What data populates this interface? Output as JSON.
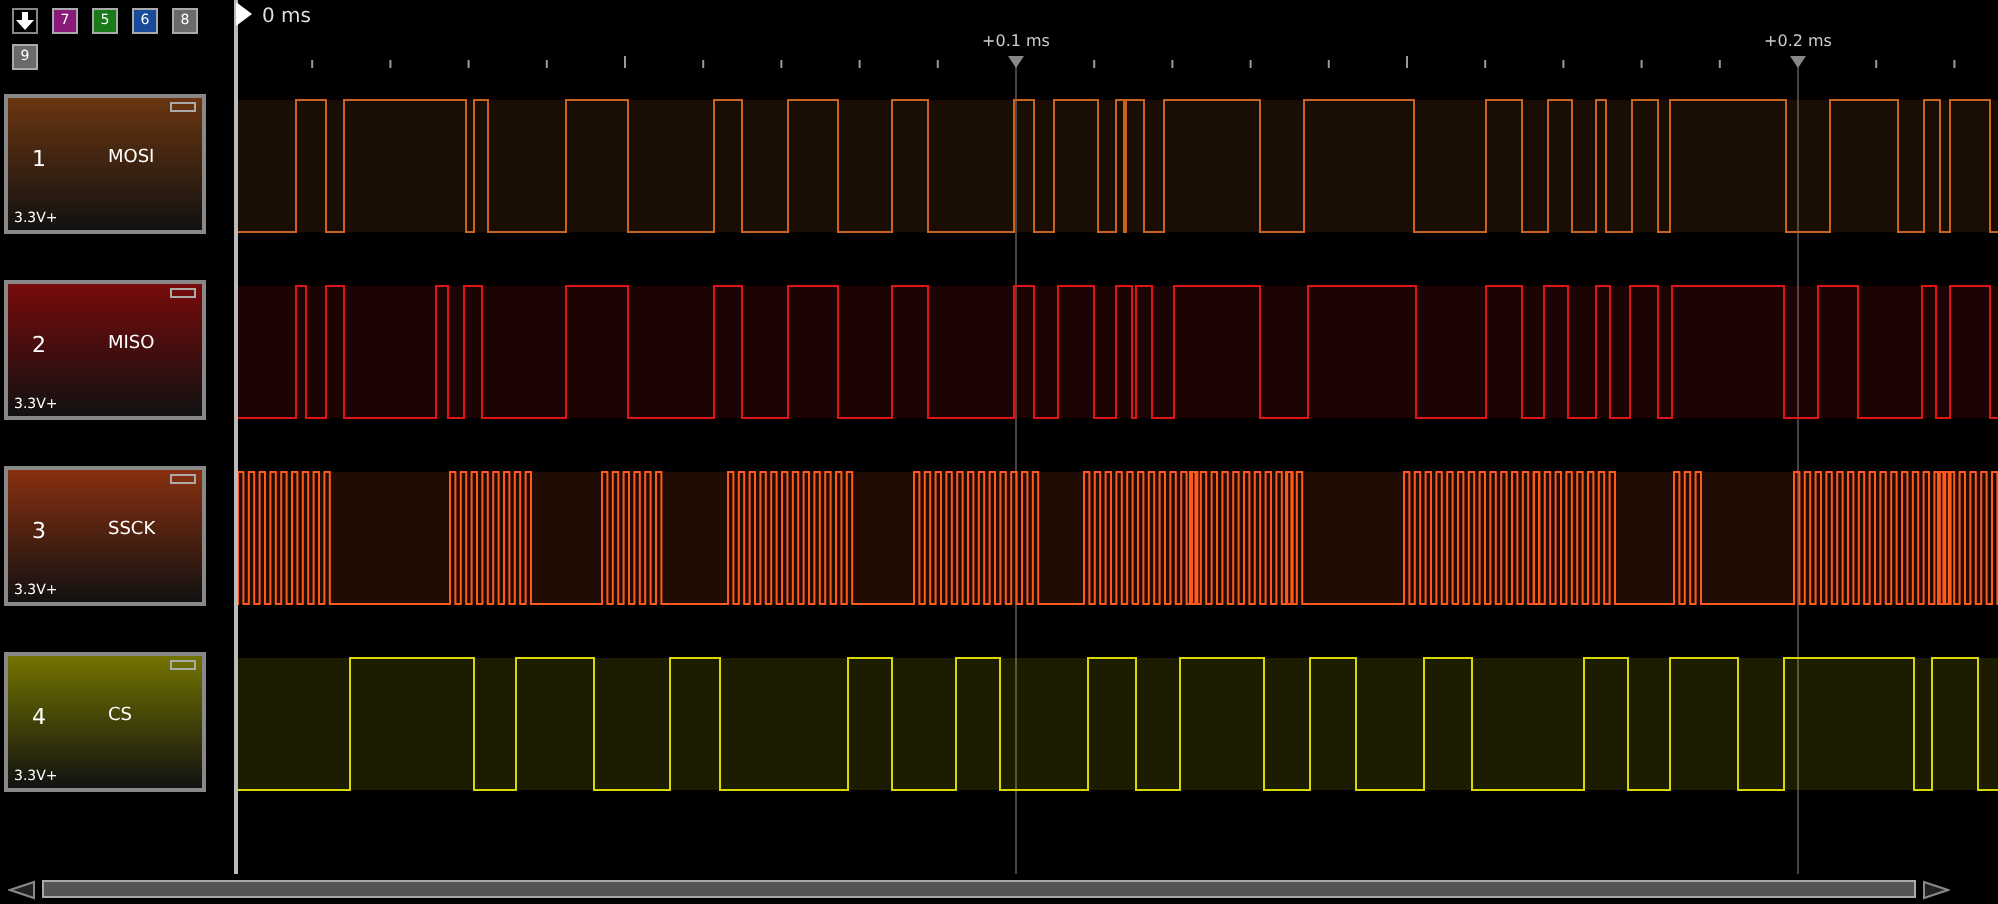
{
  "toolbar": {
    "buttons": [
      {
        "kind": "arrow"
      },
      {
        "kind": "number",
        "label": "7",
        "color": "#8a1a7a"
      },
      {
        "kind": "number",
        "label": "5",
        "color": "#1a7a1a"
      },
      {
        "kind": "number",
        "label": "6",
        "color": "#1a4a9a"
      },
      {
        "kind": "number",
        "label": "8",
        "color": "#6a6a6a"
      },
      {
        "kind": "number",
        "label": "9",
        "color": "#6a6a6a"
      }
    ]
  },
  "ruler": {
    "origin": "0 ms",
    "markers": [
      "+0.1 ms",
      "+0.2 ms"
    ]
  },
  "channels": [
    {
      "number": "1",
      "name": "MOSI",
      "voltage": "3.3V+",
      "color": "#c8641e"
    },
    {
      "number": "2",
      "name": "MISO",
      "voltage": "3.3V+",
      "color": "#e01414"
    },
    {
      "number": "3",
      "name": "SSCK",
      "voltage": "3.3V+",
      "color": "#ff5a1e"
    },
    {
      "number": "4",
      "name": "CS",
      "voltage": "3.3V+",
      "color": "#d8d800"
    }
  ]
}
